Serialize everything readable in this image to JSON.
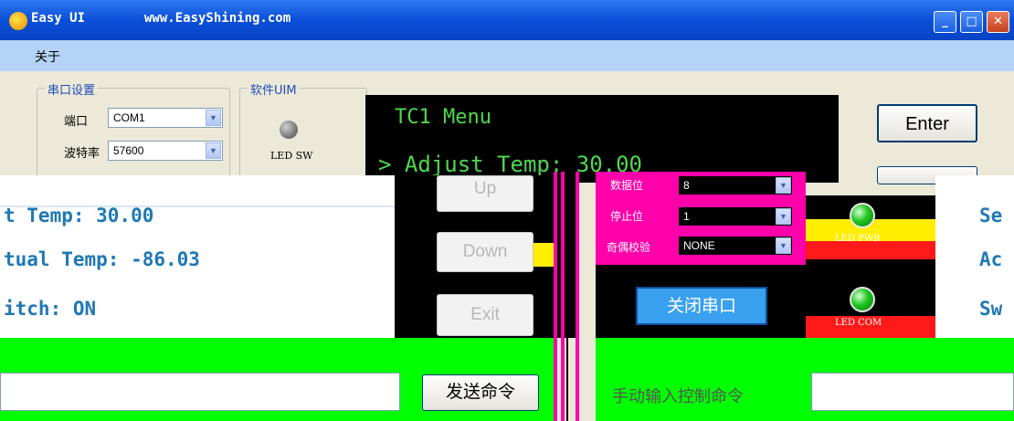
{
  "window": {
    "app_title": "Easy UI",
    "site_url": "www.EasyShining.com",
    "buttons": {
      "minimize": "_",
      "maximize": "□",
      "close": "✕"
    }
  },
  "menu": {
    "items": [
      "关于"
    ]
  },
  "serial": {
    "group_title": "串口设置",
    "port_label": "端口",
    "port_value": "COM1",
    "baud_label": "波特率",
    "baud_value": "57600",
    "data_bits_label": "数据位",
    "data_bits_value": "8",
    "stop_bits_label": "停止位",
    "stop_bits_value": "1",
    "parity_label": "奇偶校验",
    "parity_value": "NONE",
    "close_port_label": "关闭串口"
  },
  "soft_uim": {
    "group_title": "软件UIM",
    "led_sw_label": "LED SW",
    "led_pwr_label": "LED PWR",
    "led_com_label": "LED COM"
  },
  "lcd": {
    "title": "TC1 Menu",
    "line1": "> Adjust Temp: 30.00"
  },
  "buttons": {
    "enter": "Enter",
    "up": "Up",
    "down": "Down",
    "exit": "Exit",
    "send_command": "发送命令"
  },
  "status": {
    "set_temp": "t Temp: 30.00",
    "actual_temp": "tual Temp: -86.03",
    "switch": "itch: ON",
    "right_set": "Se",
    "right_actual": "Ac",
    "right_switch": "Sw"
  },
  "manual": {
    "label": "手动输入控制命令"
  },
  "colors": {
    "title_bar": "#0a4fd8",
    "menu_bar": "#b5d3f6",
    "lcd_bg": "#000000",
    "lcd_text": "#4ed84e",
    "status_text": "#1f78b4",
    "green": "#00ff00",
    "magenta": "#ff00aa",
    "yellow": "#ffee00",
    "red": "#ff1a1a"
  }
}
